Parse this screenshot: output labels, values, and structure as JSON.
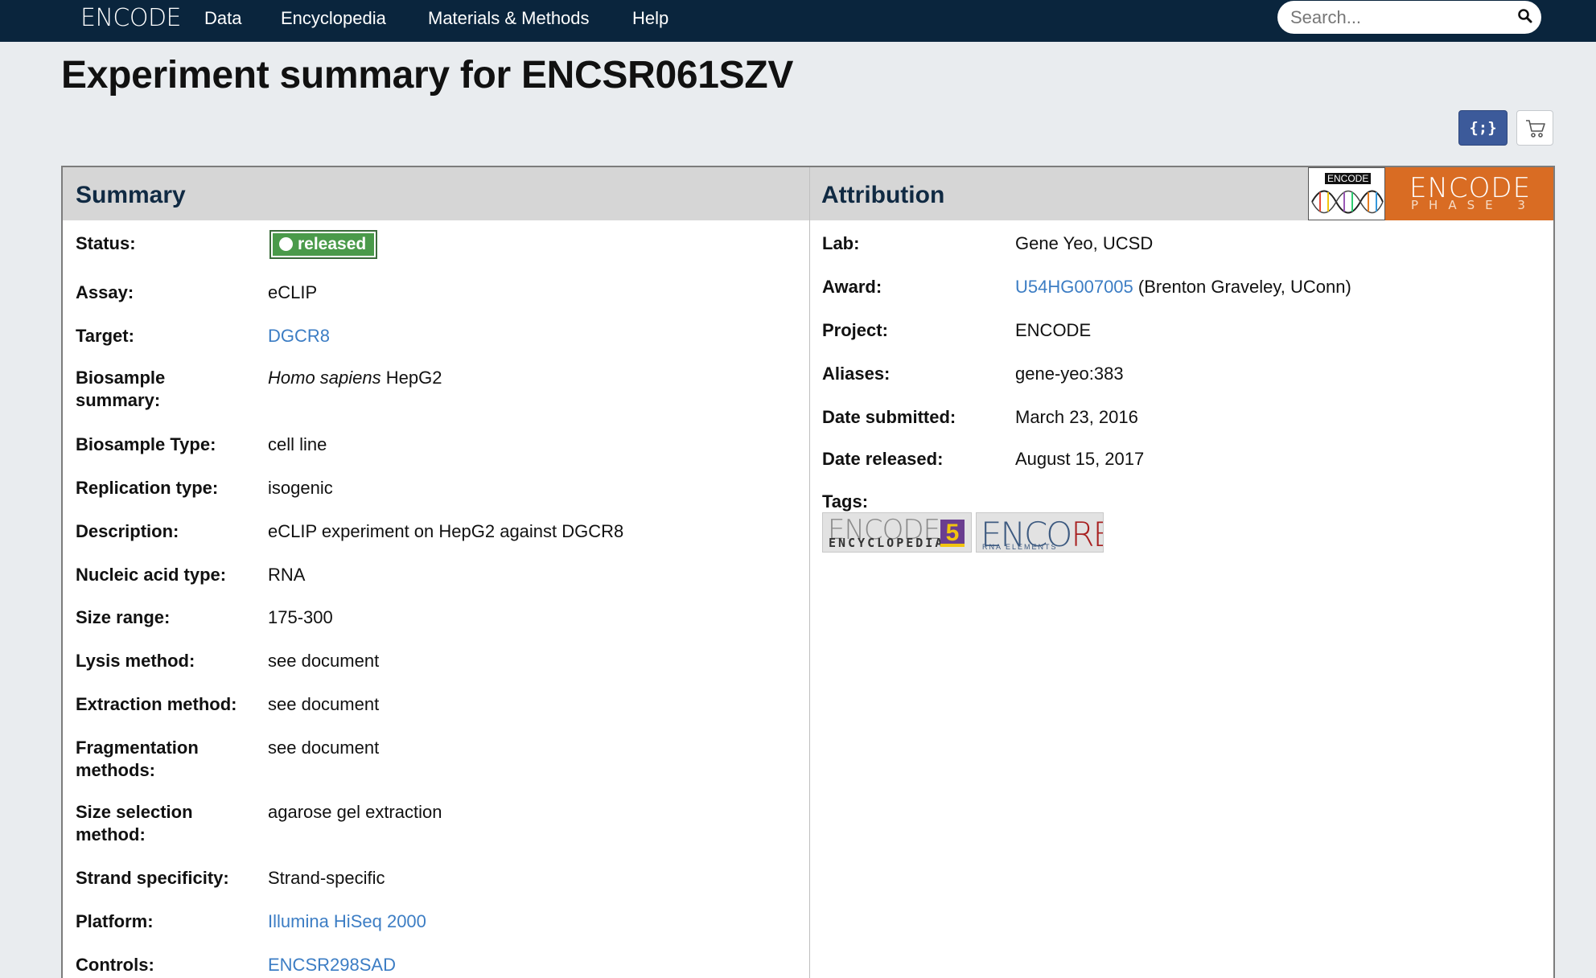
{
  "navbar": {
    "brand": "ENCODE",
    "items": [
      {
        "label": "Data"
      },
      {
        "label": "Encyclopedia"
      },
      {
        "label": "Materials & Methods"
      },
      {
        "label": "Help"
      }
    ],
    "search_placeholder": "Search...",
    "search_icon": "magnifier-icon",
    "background_color": "#0a253d"
  },
  "page": {
    "title": "Experiment summary for ENCSR061SZV"
  },
  "actions": {
    "json_label": "{;}",
    "cart_icon": "shopping-cart-icon",
    "json_color": "#3c5a9a"
  },
  "summary": {
    "heading": "Summary",
    "status_label": "Status:",
    "status_value": "released",
    "status_color": "#4a9a4a",
    "rows": [
      {
        "label": "Assay:",
        "value": "eCLIP"
      },
      {
        "label": "Target:",
        "value": "DGCR8",
        "link": true
      },
      {
        "label": "Biosample summary:",
        "value_italic": "Homo sapiens",
        "value": " HepG2"
      },
      {
        "label": "Biosample Type:",
        "value": "cell line"
      },
      {
        "label": "Replication type:",
        "value": "isogenic"
      },
      {
        "label": "Description:",
        "value": "eCLIP experiment on HepG2 against DGCR8"
      },
      {
        "label": "Nucleic acid type:",
        "value": "RNA"
      },
      {
        "label": "Size range:",
        "value": "175-300"
      },
      {
        "label": "Lysis method:",
        "value": "see document"
      },
      {
        "label": "Extraction method:",
        "value": "see document"
      },
      {
        "label": "Fragmentation methods:",
        "value": "see document"
      },
      {
        "label": "Size selection method:",
        "value": "agarose gel extraction"
      },
      {
        "label": "Strand specificity:",
        "value": "Strand-specific"
      },
      {
        "label": "Platform:",
        "value": "Illumina HiSeq 2000",
        "link": true
      },
      {
        "label": "Controls:",
        "value": "ENCSR298SAD",
        "link": true
      }
    ]
  },
  "attribution": {
    "heading": "Attribution",
    "phase_logo": {
      "dna_label": "ENCODE",
      "title": "ENCODE",
      "subtitle": "PHASE 3",
      "color": "#d96c23"
    },
    "rows": [
      {
        "label": "Lab:",
        "value": "Gene Yeo, UCSD"
      },
      {
        "label": "Award:",
        "value_link": "U54HG007005",
        "value": " (Brenton Graveley, UConn)"
      },
      {
        "label": "Project:",
        "value": "ENCODE"
      },
      {
        "label": "Aliases:",
        "value": "gene-yeo:383"
      },
      {
        "label": "Date submitted:",
        "value": "March 23, 2016"
      },
      {
        "label": "Date released:",
        "value": "August 15, 2017"
      }
    ],
    "tags_label": "Tags:",
    "tags": [
      {
        "title": "ENCODE",
        "number": "5",
        "subtitle": "ENCYCLOPEDIA"
      },
      {
        "title_main": "ENCO",
        "title_accent": "RE",
        "subtitle": "RNA ELEMENTS"
      }
    ]
  },
  "link_color": "#3c7dc4"
}
